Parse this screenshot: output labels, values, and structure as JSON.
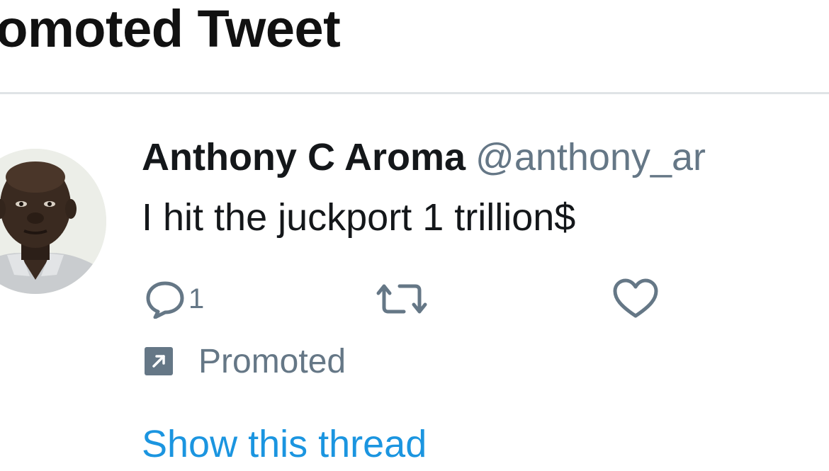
{
  "header": {
    "title": "romoted Tweet"
  },
  "tweet": {
    "display_name": "Anthony C Aroma",
    "handle": "@anthony_ar",
    "text": "I hit the juckport 1 trillion$",
    "actions": {
      "reply_count": "1",
      "reply_icon": "speech-bubble",
      "retweet_icon": "retweet-arrows",
      "like_icon": "heart"
    },
    "promoted_label": "Promoted",
    "promoted_icon": "diagonal-arrow",
    "show_thread_label": "Show this thread"
  },
  "colors": {
    "text_primary": "#14171a",
    "text_secondary": "#657786",
    "link": "#1b95e0",
    "divider": "#dfe3e6",
    "background": "#ffffff"
  }
}
